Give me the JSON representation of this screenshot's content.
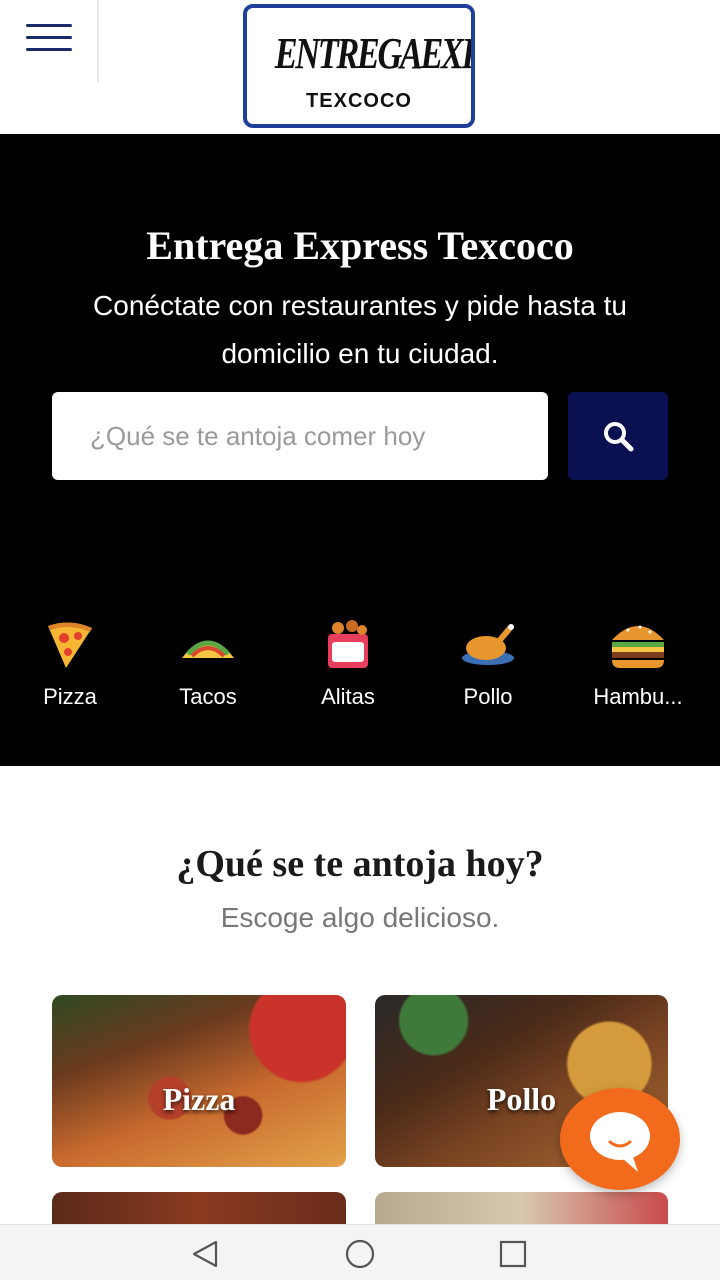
{
  "header": {
    "logo_top": "ENTREGAEXPRESS",
    "logo_bottom": "TEXCOCO",
    "brand_color": "#1f3f9a"
  },
  "hero": {
    "title": "Entrega Express Texcoco",
    "subtitle": "Conéctate con restaurantes y pide hasta tu domicilio en tu ciudad.",
    "search_placeholder": "¿Qué se te antoja comer hoy",
    "search_icon": "search-icon",
    "search_button_color": "#0b1150"
  },
  "categories": [
    {
      "label": "Pizza",
      "icon": "pizza-icon"
    },
    {
      "label": "Tacos",
      "icon": "taco-icon"
    },
    {
      "label": "Alitas",
      "icon": "wings-icon"
    },
    {
      "label": "Pollo",
      "icon": "roast-chicken-icon"
    },
    {
      "label": "Hambu...",
      "icon": "burger-icon"
    }
  ],
  "section": {
    "title": "¿Qué se te antoja hoy?",
    "subtitle": "Escoge algo delicioso."
  },
  "cards": [
    {
      "label": "Pizza"
    },
    {
      "label": "Pollo"
    }
  ],
  "chat": {
    "icon": "chat-bubble-icon",
    "color": "#f26a1b"
  },
  "navbar": {
    "icons": [
      "back-triangle-icon",
      "home-circle-icon",
      "recents-square-icon"
    ]
  }
}
